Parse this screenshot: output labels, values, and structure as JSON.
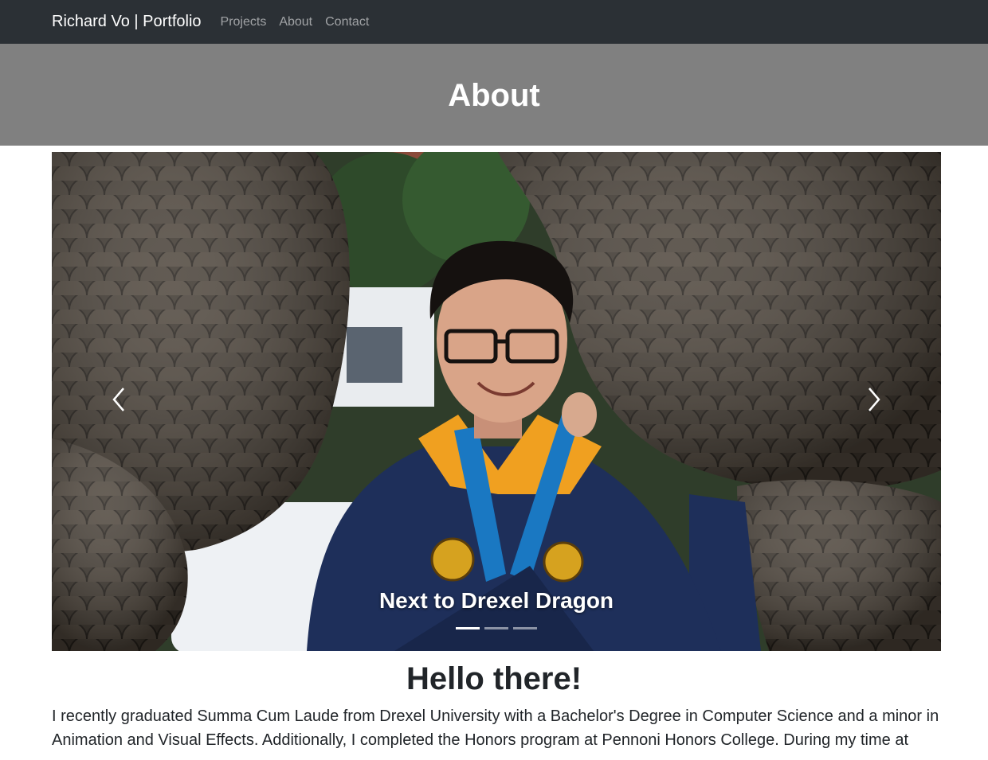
{
  "navbar": {
    "brand": "Richard Vo | Portfolio",
    "links": [
      {
        "label": "Projects"
      },
      {
        "label": "About"
      },
      {
        "label": "Contact"
      }
    ]
  },
  "header": {
    "title": "About"
  },
  "carousel": {
    "caption": "Next to Drexel Dragon",
    "slide_count": 3,
    "active_slide": 1,
    "prev_icon": "chevron-left-icon",
    "next_icon": "chevron-right-icon"
  },
  "content": {
    "greeting": "Hello there!",
    "bio": "I recently graduated Summa Cum Laude from Drexel University with a Bachelor's Degree in Computer Science and a minor in Animation and Visual Effects. Additionally, I completed the Honors program at Pennoni Honors College. During my time at"
  },
  "colors": {
    "navbar_bg": "#2b3035",
    "header_bg": "#808080",
    "gown_navy": "#1e2f5a",
    "medal_ribbon": "#1a78c2",
    "hood_gold": "#f0a020"
  }
}
